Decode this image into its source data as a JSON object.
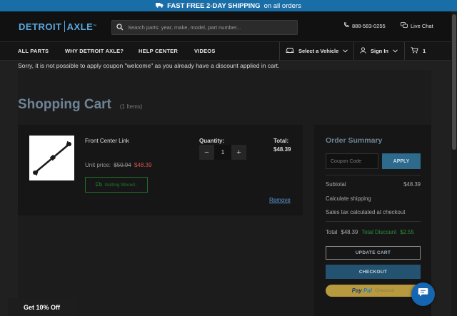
{
  "promo": {
    "bold_text": "FAST FREE 2-DAY SHIPPING",
    "light_text": "on all orders"
  },
  "header": {
    "logo_part1": "DETROIT",
    "logo_part2": "AXLE",
    "logo_tm": "™",
    "search_placeholder": "Search parts: year, make, model, part number...",
    "phone": "888-583-0255",
    "live_chat": "Live Chat"
  },
  "nav": {
    "items": [
      "ALL PARTS",
      "WHY DETROIT AXLE?",
      "HELP CENTER",
      "VIDEOS"
    ],
    "select_vehicle": "Select a Vehicle",
    "sign_in": "Sign In",
    "cart_count": "1"
  },
  "coupon_message": "Sorry, it is not possible to apply coupon \"welcome\" as you already have a discount applied in cart.",
  "cart": {
    "title": "Shopping Cart",
    "item_count": "(1 Items)",
    "item": {
      "name": "Front Center Link",
      "unit_price_label": "Unit price:",
      "old_price": "$50.94",
      "new_price": "$48.39",
      "shipping_badge": "Getting filtered..",
      "quantity_label": "Quantity:",
      "quantity": "1",
      "total_label": "Total:",
      "total_value": "$48.39",
      "remove_label": "Remove"
    }
  },
  "summary": {
    "title": "Order Summary",
    "coupon_placeholder": "Coupon Code",
    "apply_label": "APPLY",
    "subtotal_label": "Subtotal",
    "subtotal_value": "$48.39",
    "shipping_label": "Calculate shipping",
    "tax_label": "Sales tax calculated at checkout",
    "total_label": "Total",
    "total_value": "$48.39",
    "discount_label": "Total Discount",
    "discount_value": "$2.55",
    "update_label": "UPDATE CART",
    "checkout_label": "CHECKOUT",
    "paypal_pay": "Pay",
    "paypal_pal": "Pal",
    "paypal_checkout": "Checkout"
  },
  "get_off": "Get 10% Off",
  "colors": {
    "promo_bg": "#1a6ea8",
    "accent": "#5aa8e0",
    "discount_green": "#2e8b3c",
    "sale_red": "#d9534f",
    "chat_bubble": "#1665b0"
  }
}
